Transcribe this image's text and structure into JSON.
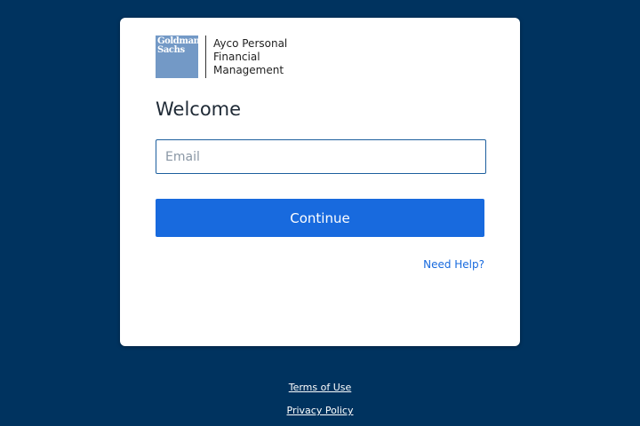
{
  "logo": {
    "mark_lines": [
      "Goldman",
      "Sachs"
    ],
    "brand_lines": [
      "Ayco Personal",
      "Financial",
      "Management"
    ]
  },
  "login": {
    "title": "Welcome",
    "email_placeholder": "Email",
    "email_value": "",
    "continue_label": "Continue",
    "help_label": "Need Help?"
  },
  "footer": {
    "terms_label": "Terms of Use",
    "privacy_label": "Privacy Policy"
  },
  "colors": {
    "background": "#00335f",
    "primary_button": "#186ade",
    "logo_box": "#7399c6",
    "link": "#186ade"
  }
}
